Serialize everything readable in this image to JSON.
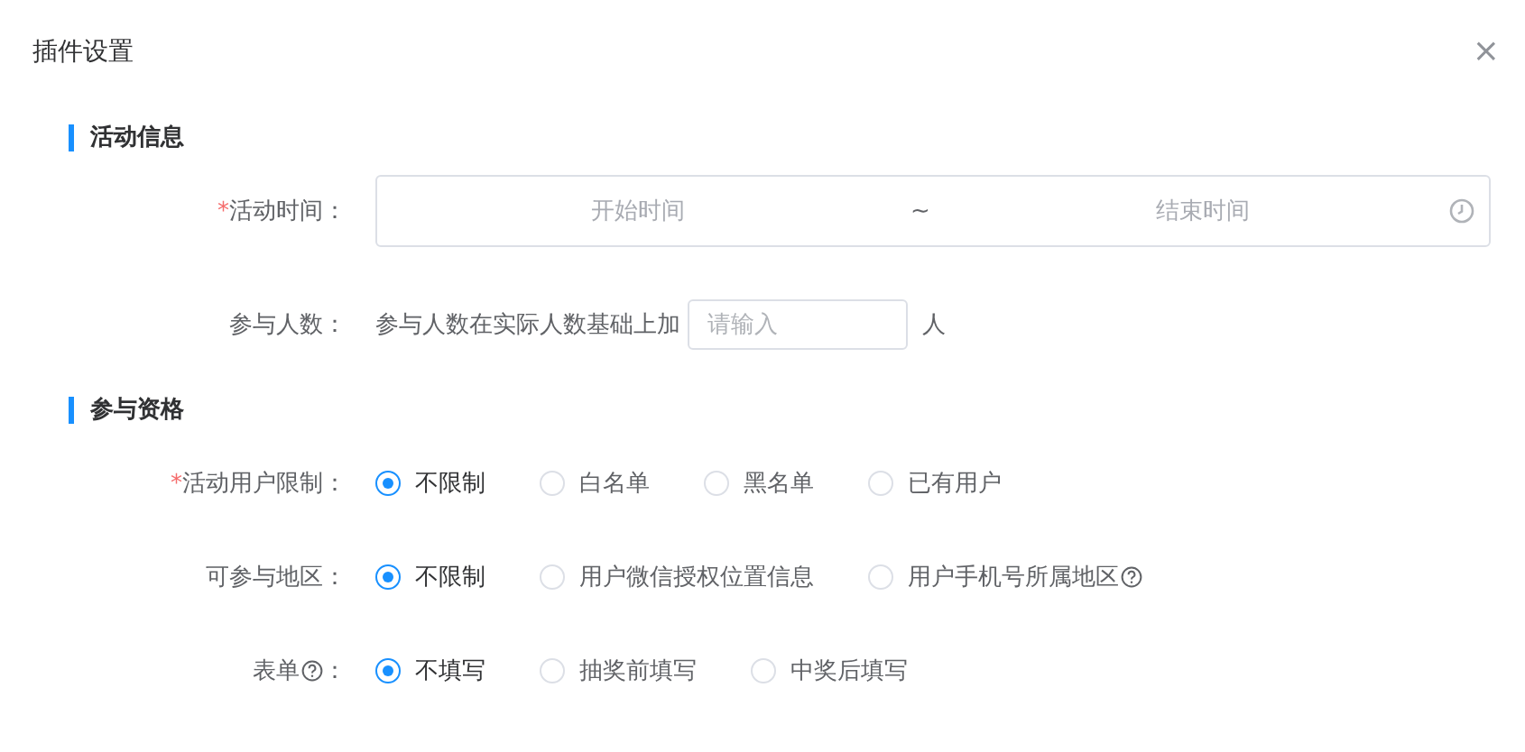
{
  "dialog": {
    "title": "插件设置",
    "close": "×"
  },
  "sections": [
    {
      "title": "活动信息",
      "rows": [
        {
          "kind": "range",
          "label": {
            "mark": "*",
            "text": "活动时间",
            "help": false,
            "colon": "："
          },
          "start_placeholder": "开始时间",
          "separator": "~",
          "end_placeholder": "结束时间"
        },
        {
          "kind": "number",
          "label": {
            "text": "参与人数",
            "help": false,
            "colon": "："
          },
          "prefix": "参与人数在实际人数基础上加",
          "placeholder": "请输入",
          "suffix": "人"
        }
      ]
    },
    {
      "title": "参与资格",
      "rows": [
        {
          "kind": "radio",
          "label": {
            "mark": "*",
            "text": "活动用户限制",
            "help": false,
            "colon": "："
          },
          "options": [
            {
              "label": "不限制",
              "selected": true,
              "help": false
            },
            {
              "label": "白名单",
              "selected": false,
              "help": false
            },
            {
              "label": "黑名单",
              "selected": false,
              "help": false
            },
            {
              "label": "已有用户",
              "selected": false,
              "help": false
            }
          ]
        },
        {
          "kind": "radio",
          "label": {
            "text": "可参与地区",
            "help": false,
            "colon": "："
          },
          "options": [
            {
              "label": "不限制",
              "selected": true,
              "help": false
            },
            {
              "label": "用户微信授权位置信息",
              "selected": false,
              "help": false
            },
            {
              "label": "用户手机号所属地区",
              "selected": false,
              "help": true
            }
          ]
        },
        {
          "kind": "radio",
          "label": {
            "text": "表单",
            "help": true,
            "colon": "："
          },
          "options": [
            {
              "label": "不填写",
              "selected": true,
              "help": false
            },
            {
              "label": "抽奖前填写",
              "selected": false,
              "help": false
            },
            {
              "label": "中奖后填写",
              "selected": false,
              "help": false
            }
          ]
        }
      ]
    }
  ]
}
